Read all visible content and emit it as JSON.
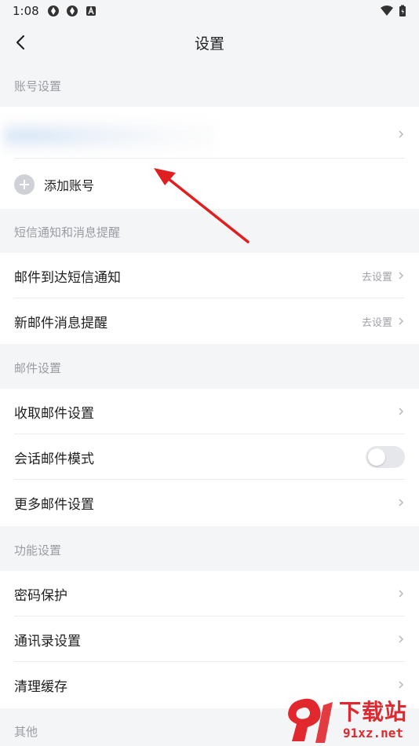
{
  "status_bar": {
    "time": "1:08"
  },
  "header": {
    "title": "设置"
  },
  "sections": {
    "account": {
      "title": "账号设置",
      "add_account": "添加账号"
    },
    "sms": {
      "title": "短信通知和消息提醒",
      "items": [
        {
          "label": "邮件到达短信通知",
          "sub": "去设置"
        },
        {
          "label": "新邮件消息提醒",
          "sub": "去设置"
        }
      ]
    },
    "mail": {
      "title": "邮件设置",
      "items": [
        {
          "label": "收取邮件设置"
        },
        {
          "label": "会话邮件模式",
          "toggle": false
        },
        {
          "label": "更多邮件设置"
        }
      ]
    },
    "features": {
      "title": "功能设置",
      "items": [
        {
          "label": "密码保护"
        },
        {
          "label": "通讯录设置"
        },
        {
          "label": "清理缓存"
        }
      ]
    },
    "other": {
      "title": "其他"
    }
  },
  "watermark": {
    "big": "下载站",
    "small": "91xz.net"
  },
  "colors": {
    "arrow": "#e02020",
    "watermark": "#e0282e"
  }
}
